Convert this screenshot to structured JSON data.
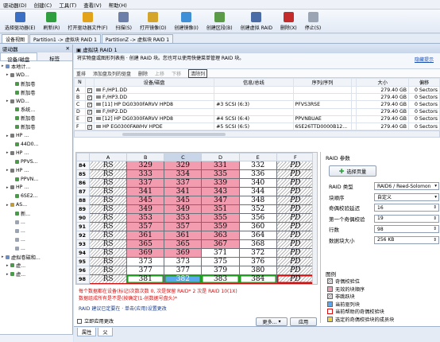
{
  "menu": [
    "驱动器(D)",
    "创建(C)",
    "工具(T)",
    "查看(V)",
    "帮助(H)"
  ],
  "toolbar": [
    {
      "label": "选择驱动器(E)",
      "color": "#3a6fc4"
    },
    {
      "label": "刷新(R)",
      "color": "#2e9e3e"
    },
    {
      "label": "打开驱动器文件(F)",
      "color": "#e2a21a"
    },
    {
      "label": "扫描(S)",
      "color": "#6b7fa8"
    },
    {
      "label": "打开镜像(O)",
      "color": "#d4a52a"
    },
    {
      "label": "创建镜像(I)",
      "color": "#3f8fd6"
    },
    {
      "label": "创建区段(B)",
      "color": "#5b9a46"
    },
    {
      "label": "创建虚拟 RAID",
      "color": "#4a6ca6"
    },
    {
      "label": "删除(X)",
      "color": "#c42c2c"
    },
    {
      "label": "停止(S)",
      "color": "#9aa4b2"
    }
  ],
  "doc_tabs": [
    "设备视图",
    "Partition1 -> 虚拟块 RAID 1",
    "PartitionZ -> 虚拟块 RAID 1"
  ],
  "left": {
    "title": "驱动器",
    "tabs": [
      "设备/磁盘",
      "标签"
    ],
    "tree": [
      "本地计...",
      "WD...",
      "新加卷",
      "新加卷",
      "WD...",
      "系统...",
      "新加卷",
      "新加卷",
      "HP ...",
      "44D0...",
      "HP ...",
      "PPVS...",
      "HP ...",
      "PPVN...",
      "HP ...",
      "6SE2...",
      "AS...",
      "新...",
      "...",
      "...",
      "...",
      "...",
      "虚拟卷磁和...",
      "虚...",
      "虚..."
    ]
  },
  "main": {
    "title": "虚拟块 RAID 1",
    "desc": "将实物盘或图形列表拖 · 创建 RAID 块。您也可以使用快捷菜单管理 RAID 块。",
    "link": "隐藏提示",
    "actions": [
      {
        "t": "重排",
        "s": "n"
      },
      {
        "t": "添加盘及列的驱盘",
        "s": "n"
      },
      {
        "t": "删除",
        "s": "n"
      },
      {
        "t": "上移",
        "s": "d"
      },
      {
        "t": "下移",
        "s": "d"
      },
      {
        "t": "清除列",
        "s": "b"
      }
    ],
    "headers": [
      "N",
      "",
      "设备/磁盘",
      "信息/总线",
      "序列/序列",
      "",
      "大小",
      "偏移"
    ],
    "rows": [
      [
        "A",
        "F:/HP1.DD",
        "",
        "",
        "279.40 GB",
        "0 Sectors"
      ],
      [
        "B",
        "F:/HP3.DD",
        "",
        "",
        "279.40 GB",
        "0 Sectors"
      ],
      [
        "C",
        "[11] HP DG0300FARVV HPD8",
        "#3 SCSI (6:3)",
        "PFVS3RSE",
        "279.40 GB",
        "0 Sectors"
      ],
      [
        "D",
        "F:/HP2.DD",
        "",
        "",
        "279.40 GB",
        "0 Sectors"
      ],
      [
        "E",
        "[12] HP DG0300FARVV HPD8",
        "#4 SCSI (6:4)",
        "PPVNBUAE",
        "279.40 GB",
        "0 Sectors"
      ],
      [
        "F",
        "HP EG0300FAWHV HPDE",
        "#5 SCSI (6:5)",
        "6SE26TTD0000B12...",
        "279.40 GB",
        "0 Sectors"
      ]
    ]
  },
  "grid": {
    "cols": [
      "A",
      "B",
      "C",
      "D",
      "E",
      "F"
    ],
    "rows": [
      {
        "n": "84",
        "c": [
          "RS",
          "329",
          "329",
          "331",
          "332",
          "PD"
        ],
        "k": [
          "rs",
          "pk",
          "pk",
          "pk",
          "wh",
          "pd"
        ]
      },
      {
        "n": "85",
        "c": [
          "RS",
          "333",
          "334",
          "335",
          "336",
          "PD"
        ],
        "k": [
          "rs",
          "pk",
          "pk",
          "pk",
          "wh",
          "pd"
        ]
      },
      {
        "n": "86",
        "c": [
          "RS",
          "337",
          "337",
          "339",
          "340",
          "PD"
        ],
        "k": [
          "rs",
          "pk",
          "pk",
          "pk",
          "wh",
          "pd"
        ]
      },
      {
        "n": "87",
        "c": [
          "RS",
          "341",
          "341",
          "343",
          "344",
          "PD"
        ],
        "k": [
          "rs",
          "pk",
          "pk",
          "pk",
          "wh",
          "pd"
        ]
      },
      {
        "n": "88",
        "c": [
          "RS",
          "345",
          "345",
          "347",
          "348",
          "PD"
        ],
        "k": [
          "rs",
          "pk",
          "pk",
          "pk",
          "wh",
          "pd"
        ]
      },
      {
        "n": "89",
        "c": [
          "RS",
          "349",
          "349",
          "351",
          "352",
          "PD"
        ],
        "k": [
          "rs",
          "pk",
          "pk",
          "pk",
          "wh",
          "pd"
        ]
      },
      {
        "n": "90",
        "c": [
          "RS",
          "353",
          "353",
          "355",
          "356",
          "PD"
        ],
        "k": [
          "rs",
          "pk",
          "pk",
          "pk",
          "wh",
          "pd"
        ]
      },
      {
        "n": "91",
        "c": [
          "RS",
          "357",
          "357",
          "359",
          "360",
          "PD"
        ],
        "k": [
          "rs",
          "pk",
          "pk",
          "pk",
          "wh",
          "pd"
        ]
      },
      {
        "n": "92",
        "c": [
          "RS",
          "361",
          "361",
          "363",
          "364",
          "PD"
        ],
        "k": [
          "rs",
          "pk",
          "pk",
          "pk",
          "wh",
          "pd"
        ]
      },
      {
        "n": "93",
        "c": [
          "RS",
          "365",
          "365",
          "367",
          "368",
          "PD"
        ],
        "k": [
          "rs",
          "pk",
          "pk",
          "pk",
          "wh",
          "pd"
        ]
      },
      {
        "n": "94",
        "c": [
          "RS",
          "369",
          "369",
          "371",
          "372",
          "PD"
        ],
        "k": [
          "rs",
          "pk",
          "pk",
          "wh",
          "wh",
          "pd"
        ]
      },
      {
        "n": "95",
        "c": [
          "RS",
          "373",
          "373",
          "375",
          "376",
          "PD"
        ],
        "k": [
          "rs",
          "wh",
          "wh",
          "wh",
          "wh",
          "pd"
        ]
      },
      {
        "n": "96",
        "c": [
          "RS",
          "377",
          "377",
          "379",
          "380",
          "PD"
        ],
        "k": [
          "rs",
          "wh",
          "wh",
          "wh",
          "wh",
          "pd"
        ]
      },
      {
        "n": "98",
        "c": [
          "RS",
          "381",
          "382",
          "383",
          "384",
          "PD"
        ],
        "k": [
          "rs",
          "wh gb",
          "bl gb",
          "wh gb",
          "wh gb",
          "pd rb"
        ]
      }
    ]
  },
  "info": "每个数据都在设备(标记)次数次数 0, 次是保留 RAID* 2 次是 RAID 10(1X)\n数据组成所有是不是(按确定(1-创数据号盘头)*",
  "hint": "RAID 建议已定要在 · 单击(应用)设置更改",
  "autoapply": "立即应用更改",
  "btn_more": "更多...",
  "btn_apply": "应用",
  "params": {
    "title": "RAID 参数",
    "select_btn": "选择页量",
    "fields": [
      {
        "l": "RAID 类型",
        "v": "RAID6 / Reed-Solomon"
      },
      {
        "l": "块顺序",
        "v": "自定义"
      },
      {
        "l": "奇偶校验延迟",
        "v": "16"
      },
      {
        "l": "第一个奇偶校验",
        "v": "19"
      },
      {
        "l": "行数",
        "v": "98"
      },
      {
        "l": "数据块大小",
        "v": "256 KB"
      }
    ],
    "legend_title": "图例",
    "legend": [
      {
        "t": "奇偶校验位",
        "c": "#ffffff"
      },
      {
        "t": "无效的块顺序",
        "c": "#f39cb0"
      },
      {
        "t": "非跳跃块",
        "c": "#ffffff"
      },
      {
        "t": "当前驱列块",
        "c": "#5aa8ee"
      },
      {
        "t": "当前帮助的奇偶校验块",
        "c": "#ffffff"
      },
      {
        "t": "选定的奇偶校验块的成员块",
        "c": "#f2d23c"
      }
    ]
  },
  "bottom_tabs": [
    "属性",
    "父"
  ]
}
